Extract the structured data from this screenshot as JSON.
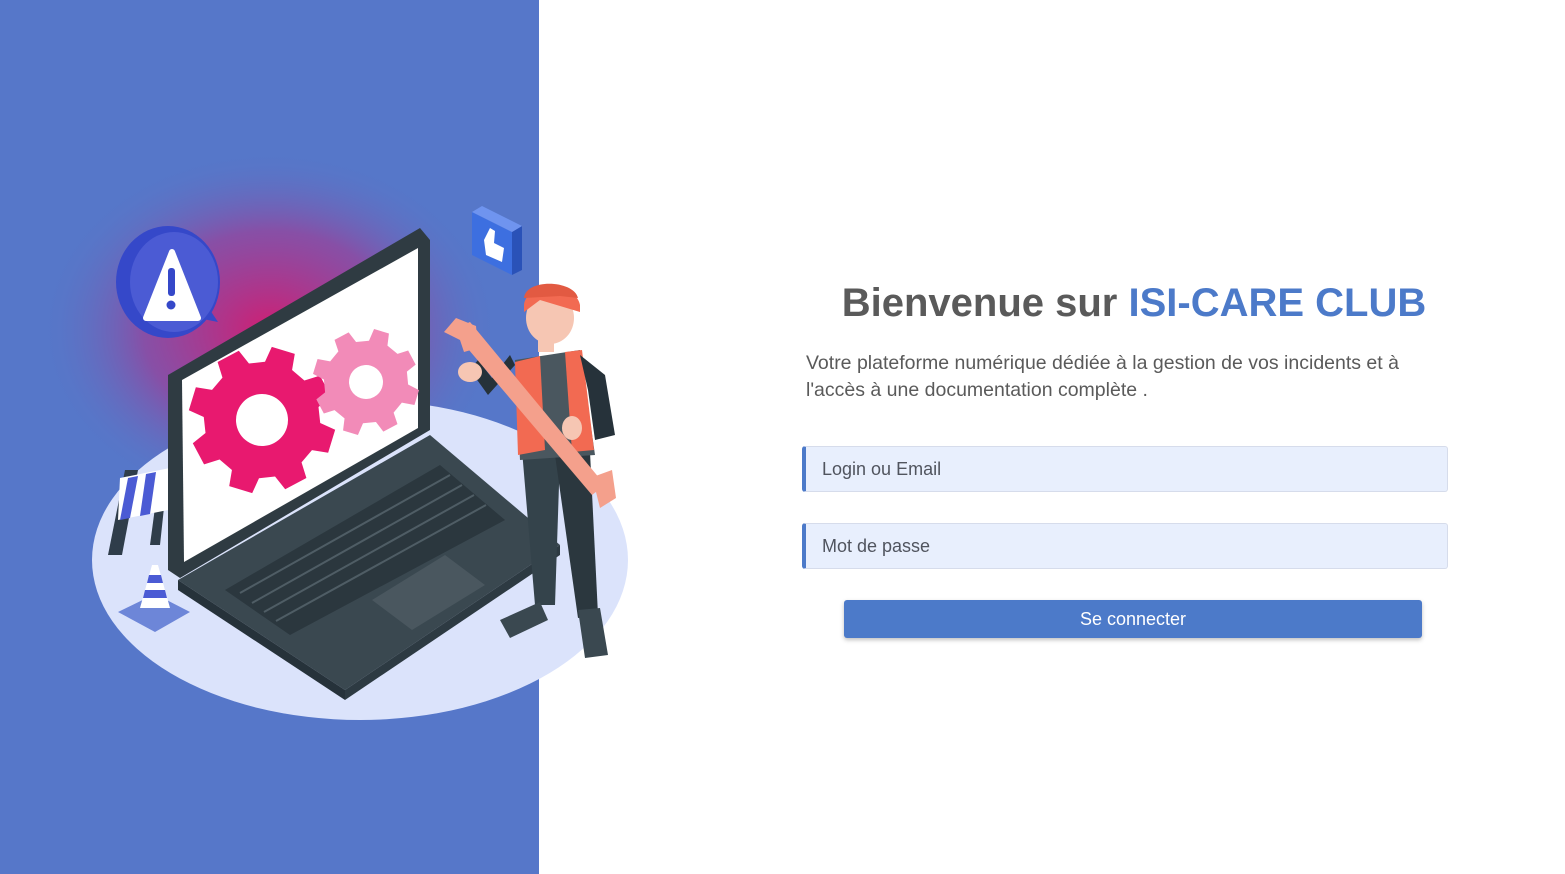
{
  "header": {
    "title_prefix": "Bienvenue sur ",
    "title_brand": "ISI-CARE CLUB",
    "subtitle": "Votre plateforme numérique dédiée à la gestion de vos incidents et à l'accès à une documentation complète ."
  },
  "form": {
    "login_placeholder": "Login ou Email",
    "password_placeholder": "Mot de passe",
    "submit_label": "Se connecter"
  },
  "illustration": {
    "icons": [
      "warning-icon",
      "thumbs-up-icon",
      "gear-icon",
      "wrench-icon",
      "traffic-cone-icon",
      "barrier-icon"
    ]
  },
  "colors": {
    "panel_blue": "#5677c9",
    "accent_blue": "#4c7ac9",
    "field_background": "#e8effd",
    "gear_primary": "#e8196f",
    "gear_secondary": "#f28bb8"
  }
}
